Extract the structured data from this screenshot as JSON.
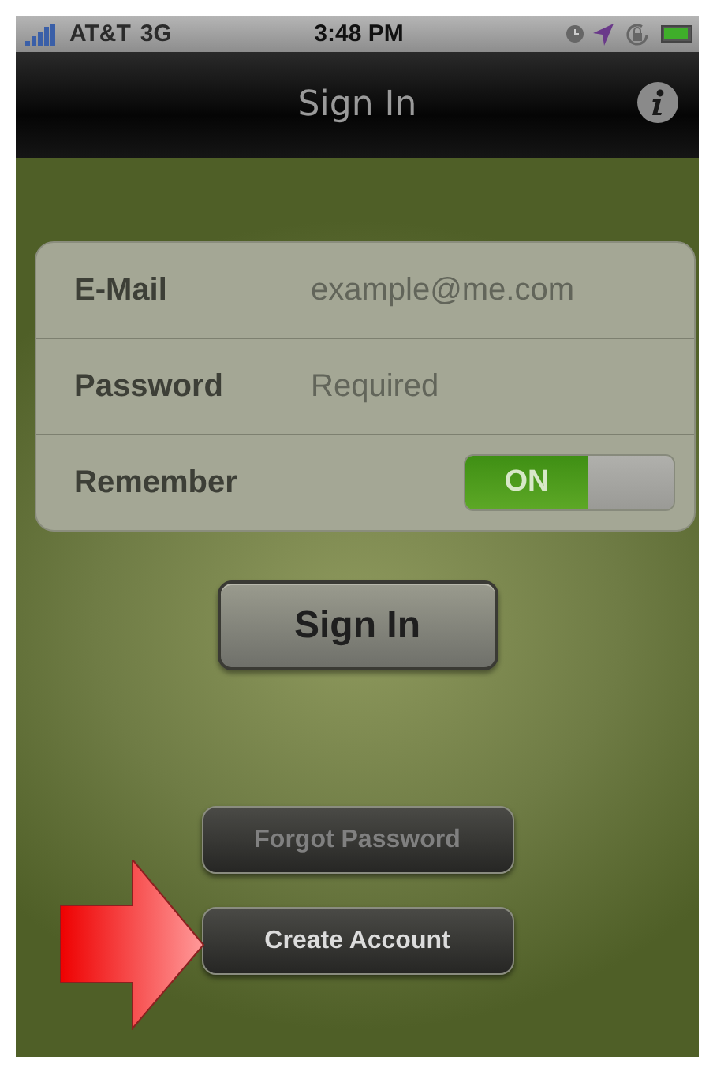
{
  "status_bar": {
    "carrier": "AT&T",
    "network": "3G",
    "time": "3:48 PM"
  },
  "nav_bar": {
    "title": "Sign In"
  },
  "form": [
    {
      "kind": "field",
      "label": "E-Mail",
      "placeholder": "example@me.com"
    },
    {
      "kind": "field",
      "label": "Password",
      "placeholder": "Required"
    },
    {
      "kind": "toggle",
      "label": "Remember",
      "on": true,
      "state_text": "ON"
    }
  ],
  "sign_in_button": {
    "label": "Sign In"
  },
  "buttons": [
    {
      "label": "Forgot Password",
      "disabled": true
    },
    {
      "label": "Create Account",
      "disabled": false
    }
  ]
}
